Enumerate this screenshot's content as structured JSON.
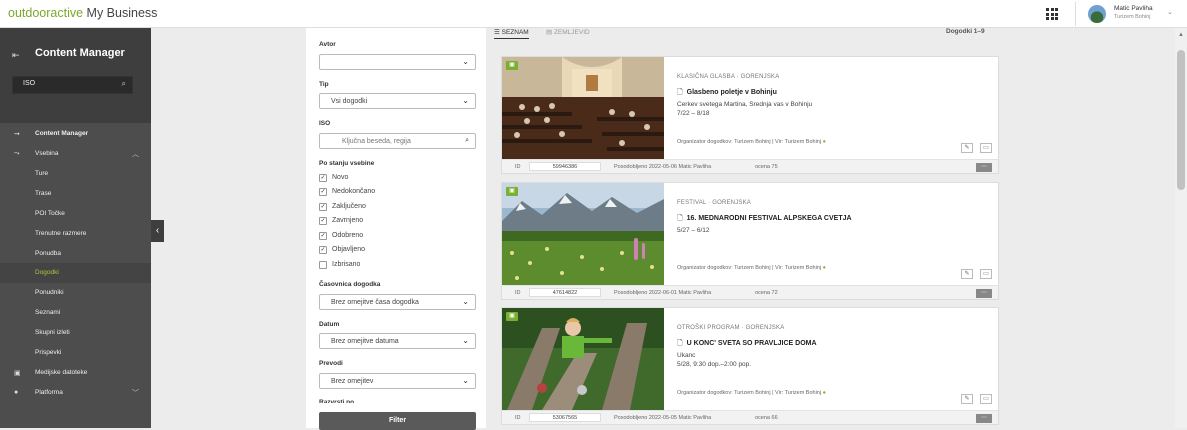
{
  "header": {
    "brand_part1": "outdooractive",
    "brand_part2": "My Business",
    "user_name": "Matic Pavliha",
    "user_org": "Turizem Bohinj"
  },
  "sidebar": {
    "title": "Content Manager",
    "search_value": "ISO",
    "items": [
      {
        "label": "Content Manager"
      },
      {
        "label": "Vsebina"
      },
      {
        "label": "Ture"
      },
      {
        "label": "Trase"
      },
      {
        "label": "POI Točke"
      },
      {
        "label": "Trenutne razmere"
      },
      {
        "label": "Ponudba"
      },
      {
        "label": "Dogodki"
      },
      {
        "label": "Ponudniki"
      },
      {
        "label": "Seznami"
      },
      {
        "label": "Skupni izleti"
      },
      {
        "label": "Prispevki"
      },
      {
        "label": "Medijske datoteke"
      },
      {
        "label": "Platforma"
      }
    ]
  },
  "filters": {
    "avtor_label": "Avtor",
    "avtor_value": "",
    "tip_label": "Tip",
    "tip_value": "Vsi dogodki",
    "iso_label": "ISO",
    "iso_placeholder": "Ključna beseda, regija",
    "status_label": "Po stanju vsebine",
    "statuses": [
      {
        "label": "Novo",
        "mark": "✓"
      },
      {
        "label": "Nedokončano",
        "mark": "✓"
      },
      {
        "label": "Zaključeno",
        "mark": "✓"
      },
      {
        "label": "Zavrnjeno",
        "mark": "✓"
      },
      {
        "label": "Odobreno",
        "mark": "✓"
      },
      {
        "label": "Objavljeno",
        "mark": "✓"
      },
      {
        "label": "Izbrisano",
        "mark": ""
      }
    ],
    "casovnica_label": "Časovnica dogodka",
    "casovnica_value": "Brez omejitve časa dogodka",
    "datum_label": "Datum",
    "datum_value": "Brez omejitve datuma",
    "prevodi_label": "Prevodi",
    "prevodi_value": "Brez omejitev",
    "cut_label": "Razvrsti po",
    "filter_button": "Filter"
  },
  "list": {
    "tab_list": "SEZNAM",
    "tab_map": "ZEMLJEVID",
    "count": "Dogodki 1–9",
    "events": [
      {
        "category": "KLASIČNA GLASBA · GORENJSKA",
        "title": "Glasbeno poletje v Bohinju",
        "line1": "Cerkev svetega Martina, Srednja vas v Bohinju",
        "line2": "7/22 – 8/18",
        "org": "Organizator dogodkov: Turizem Bohinj | Vir: Turizem Bohinj",
        "id_label": "ID",
        "id": "59946386",
        "edited": "Posodobljeno   2022-05-06 Matic Pavliha",
        "rating": "ocena   75"
      },
      {
        "category": "FESTIVAL · GORENJSKA",
        "title": "16. MEDNARODNI FESTIVAL ALPSKEGA CVETJA",
        "line1": "5/27 – 6/12",
        "line2": "",
        "org": "Organizator dogodkov: Turizem Bohinj | Vir: Turizem Bohinj",
        "id_label": "ID",
        "id": "47614822",
        "edited": "Posodobljeno   2022-06-01 Matic Pavliha",
        "rating": "ocena   72"
      },
      {
        "category": "OTROŠKI PROGRAM · GORENJSKA",
        "title": "U KONC' SVETA SO PRAVLJICE DOMA",
        "line1": "Ukanc",
        "line2": "5/28, 9:30 dop.–2:00 pop.",
        "org": "Organizator dogodkov: Turizem Bohinj | Vir: Turizem Bohinj",
        "id_label": "ID",
        "id": "53067565",
        "edited": "Posodobljeno   2022-05-05 Matic Pavliha",
        "rating": "ocena   66"
      }
    ]
  },
  "colors": {
    "accent": "#7ab030",
    "sidebar_bg": "#4d4d4d",
    "sidebar_active": "#a6c63a"
  }
}
